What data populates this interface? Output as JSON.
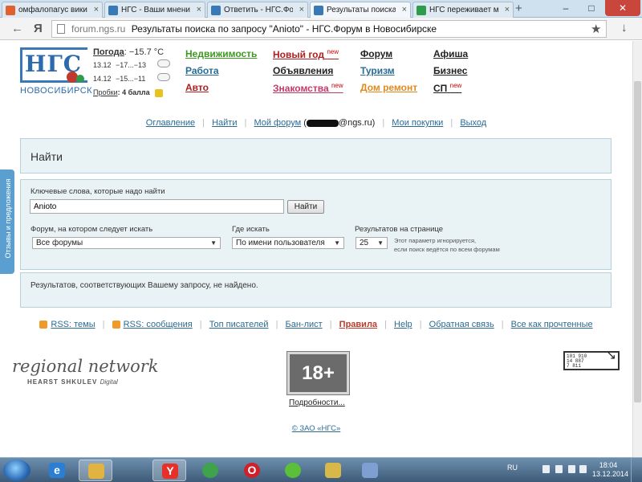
{
  "browser": {
    "tabs": [
      {
        "title": "омфалопагус википе",
        "icon_color": "#e06030"
      },
      {
        "title": "НГС - Ваши мнения и",
        "icon_color": "#3a79b8"
      },
      {
        "title": "Ответить - НГС.Форум",
        "icon_color": "#3a79b8"
      },
      {
        "title": "Результаты поиска п",
        "icon_color": "#3a79b8",
        "active": true
      },
      {
        "title": "НГС переживает масс",
        "icon_color": "#2e9c4a"
      }
    ],
    "new_tab": "+",
    "window_controls": [
      "–",
      "□",
      "✕"
    ],
    "back": "←",
    "yandex_logo": "Я",
    "url_domain": "forum.ngs.ru",
    "url_title": "Результаты поиска по запросу \"Anioto\" - НГС.Форум в Новосибирске",
    "bookmark": "★",
    "download": "↓"
  },
  "header": {
    "logo_text": "НГС",
    "city": "НОВОСИБИРСК",
    "weather": {
      "title": "Погода",
      "current": ": −15.7 °C",
      "rows": [
        {
          "date": "13.12",
          "temp": "−17...−13"
        },
        {
          "date": "14.12",
          "temp": "−15...−11"
        }
      ],
      "traffic_label": "Пробки",
      "traffic_value": ": 4 балла"
    },
    "nav": [
      {
        "label": "Недвижимость",
        "color": "#3d9a1e",
        "new": ""
      },
      {
        "label": "Работа",
        "color": "#2a6b94",
        "new": ""
      },
      {
        "label": "Авто",
        "color": "#b02020",
        "new": ""
      },
      {
        "label": "Новый год",
        "color": "#b02020",
        "new": "new"
      },
      {
        "label": "Объявления",
        "color": "#222222",
        "new": ""
      },
      {
        "label": "Знакомства",
        "color": "#c23a6b",
        "new": "new"
      },
      {
        "label": "Форум",
        "color": "#222222",
        "new": ""
      },
      {
        "label": "Туризм",
        "color": "#2a6b94",
        "new": ""
      },
      {
        "label": "Дом ремонт",
        "color": "#e08a1e",
        "new": ""
      },
      {
        "label": "Афиша",
        "color": "#222222",
        "new": ""
      },
      {
        "label": "Бизнес",
        "color": "#222222",
        "new": ""
      },
      {
        "label": "СП",
        "color": "#222222",
        "new": "new"
      }
    ]
  },
  "toplinks": {
    "contents": "Оглавление",
    "find": "Найти",
    "my_forum": "Мой форум",
    "my_forum_email": "@ngs.ru)",
    "my_forum_open": " (",
    "purchases": "Мои покупки",
    "logout": "Выход",
    "sep": "|"
  },
  "search": {
    "heading": "Найти",
    "keywords_label": "Ключевые слова, которые надо найти",
    "keywords_value": "Anioto",
    "find_button": "Найти",
    "forum_label": "Форум, на котором следует искать",
    "forum_value": "Все форумы",
    "where_label": "Где искать",
    "where_value": "По имени пользователя",
    "per_page_label": "Результатов на странице",
    "per_page_value": "25",
    "note_line1": "Этот параметр игнорируется,",
    "note_line2": "если поиск ведётся по всем форумам",
    "caret": "▼",
    "result_text": "Результатов, соответствующих Вашему запросу, не найдено."
  },
  "bottomlinks": {
    "rss_topics": "RSS: темы",
    "rss_messages": "RSS: сообщения",
    "top_writers": "Топ писателей",
    "ban_list": "Бан-лист",
    "rules": "Правила",
    "help": "Help",
    "feedback": "Обратная связь",
    "mark_read": "Все как прочтенные",
    "sep": "|"
  },
  "footer": {
    "regional": "regional network",
    "hearst": "HEARST SHKULEV",
    "digital": "Digital",
    "age": "18+",
    "details": "Подробности...",
    "copyright": "© ЗАО «НГС»",
    "counter_line1": "101 910",
    "counter_line2": "14 887",
    "counter_line3": "7 811",
    "counter_arrow": "↘"
  },
  "sidetab": "Отзывы и предложения",
  "taskbar": {
    "apps": [
      {
        "name": "ie",
        "color": "#2a7fd4",
        "glyph": "e"
      },
      {
        "name": "explorer",
        "color": "#e3b341",
        "glyph": ""
      },
      {
        "name": "yandex",
        "color": "#e8302a",
        "glyph": "Y"
      },
      {
        "name": "chrome",
        "color": "#3ea34a",
        "glyph": ""
      },
      {
        "name": "opera",
        "color": "#d0202a",
        "glyph": "O"
      },
      {
        "name": "icq",
        "color": "#5bbf3a",
        "glyph": ""
      },
      {
        "name": "folder",
        "color": "#d8b849",
        "glyph": ""
      },
      {
        "name": "paint",
        "color": "#7d9fd1",
        "glyph": ""
      }
    ],
    "lang": "RU",
    "time": "18:04",
    "date": "13.12.2014"
  }
}
